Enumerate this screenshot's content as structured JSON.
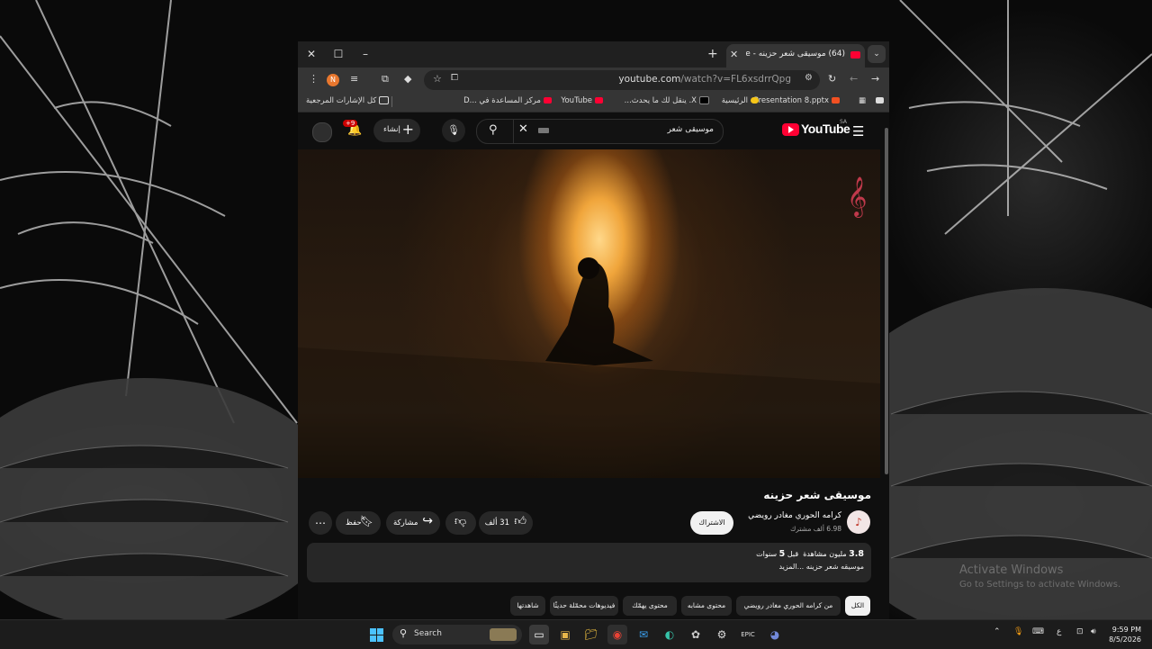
{
  "desktop": {
    "activate_title": "Activate Windows",
    "activate_sub": "Go to Settings to activate Windows."
  },
  "browser": {
    "tab_title": "(64) موسيقى شعر حزينه - YouTube",
    "url_host": "youtube.com",
    "url_path": "/watch?v=FL6xsdrrQpg",
    "profile_initial": "N",
    "bookmarks": [
      {
        "label": "Presentation 8.pptx",
        "icon": "office-icon",
        "color": "#f25022"
      },
      {
        "label": "الرئيسية",
        "icon": "lightbulb-icon",
        "color": "#f5c518"
      },
      {
        "label": "X. ينقل لك ما يحدث...",
        "icon": "x-logo-icon",
        "color": "#000000"
      },
      {
        "label": "YouTube",
        "icon": "youtube-icon",
        "color": "#ff0033"
      },
      {
        "label": "مركز المساعدة في ...D",
        "icon": "youtube-icon",
        "color": "#ff0033"
      },
      {
        "label": "كل الإشارات المرجعية",
        "icon": "folder-icon",
        "color": "#dddddd"
      }
    ]
  },
  "youtube": {
    "logo_text": "YouTube",
    "country_code": "SA",
    "search_query": "موسيقى شعر",
    "create_label": "إنشاء",
    "notif_count": "+9",
    "video": {
      "title": "موسيقى شعر حزينه",
      "channel": "كرامه الحوري مغادر رويضي",
      "subscribers": "6.98 ألف مشترك",
      "subscribe_label": "الاشتراك",
      "likes": "31 ألف",
      "share_label": "مشاركة",
      "save_label": "حفظ",
      "views": "3.8",
      "views_suffix": "مليون مشاهدة",
      "age_prefix": "قبل",
      "age_num": "5",
      "age_unit": "سنوات",
      "description": "موسيقه شعر حزينه ...المزيد"
    },
    "chips": [
      {
        "label": "الكل",
        "active": true
      },
      {
        "label": "من كرامه الحوري مغادر رويضي",
        "active": false
      },
      {
        "label": "محتوى مشابه",
        "active": false
      },
      {
        "label": "محتوى يهمّك",
        "active": false
      },
      {
        "label": "فيديوهات محمّلة حديثًا",
        "active": false
      },
      {
        "label": "شاهدتها",
        "active": false
      }
    ]
  },
  "taskbar": {
    "search_label": "Search",
    "time": "9:59 PM",
    "date": "8/5/2026",
    "lang": "ع"
  }
}
